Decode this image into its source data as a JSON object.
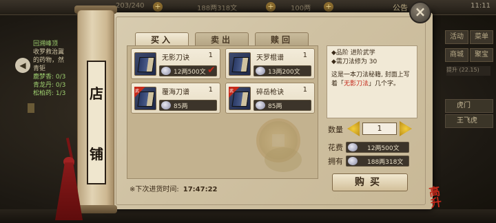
{
  "topbar": {
    "res1": "203/240",
    "res2": "188两318文",
    "res3": "100两",
    "announce": "公告",
    "sysinfo": "11:11"
  },
  "quest": {
    "title": "回溯峰顶",
    "lines": [
      "收罗救治冀",
      "的药物，然",
      "青钜"
    ],
    "goals": [
      "鹿梦香: 0/3",
      "青龙丹: 0/3",
      "松柏药: 1/3"
    ]
  },
  "right_menu": {
    "buttons": [
      "活动",
      "菜单",
      "商城",
      "聚宝"
    ],
    "info": "提升 (22.15)",
    "cards": [
      "虎门",
      "王飞虎"
    ]
  },
  "scroll": {
    "title_chars": [
      "店",
      "铺"
    ]
  },
  "tabs": [
    {
      "label": "买入",
      "active": true
    },
    {
      "label": "卖出",
      "active": false
    },
    {
      "label": "赎回",
      "active": false
    }
  ],
  "items": [
    {
      "name": "无影刀诀",
      "qty": "1",
      "price": "12两500文",
      "selected": true,
      "tag": ""
    },
    {
      "name": "天罗棍谱",
      "qty": "1",
      "price": "13两200文",
      "selected": false,
      "tag": ""
    },
    {
      "name": "覆海刀谱",
      "qty": "1",
      "price": "85两",
      "selected": false,
      "tag": "武"
    },
    {
      "name": "碎岳枪诀",
      "qty": "1",
      "price": "85两",
      "selected": false,
      "tag": "武"
    }
  ],
  "restock": {
    "label": "※下次进货时间:",
    "time": "17:47:22"
  },
  "detail": {
    "grade": "◆品阶  进阶武学",
    "require": "◆需刀法修为 30",
    "desc_prefix": "这是一本刀法秘籍, 封面上写着「",
    "desc_name": "无影刀法",
    "desc_suffix": "」几个字。"
  },
  "purchase": {
    "qty_label": "数量",
    "qty_value": "1",
    "cost_label": "花费",
    "cost_value": "12两500文",
    "own_label": "拥有",
    "own_value": "188两318文",
    "buy_label": "购买"
  },
  "close_label": "×",
  "logo_text": "高升"
}
